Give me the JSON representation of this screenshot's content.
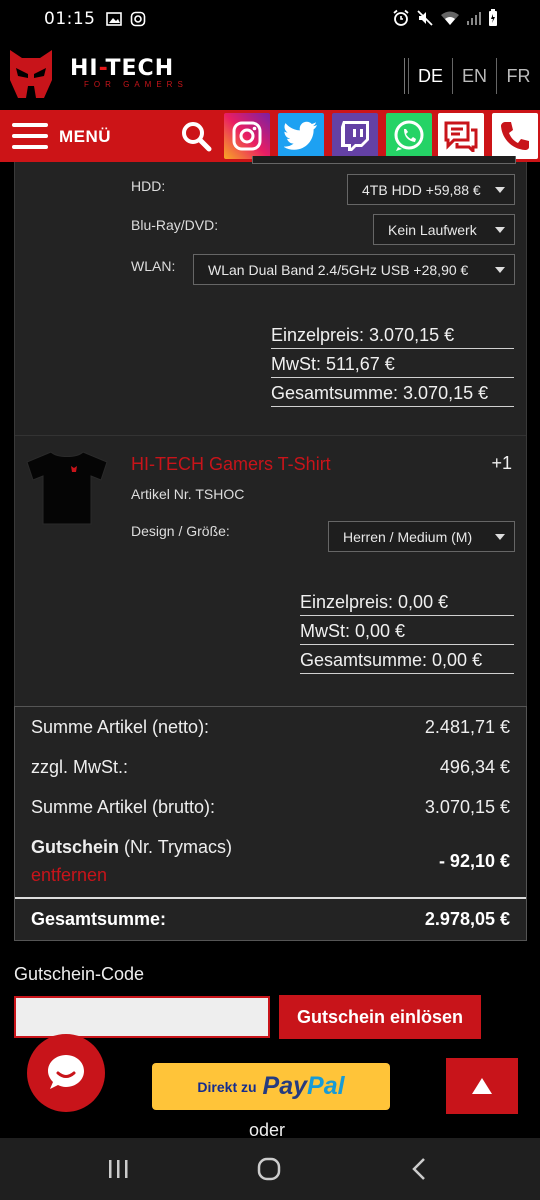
{
  "status_bar": {
    "time": "01:15"
  },
  "header": {
    "brand_main": "HI-TECH",
    "brand_sub": "FOR GAMERS",
    "languages": [
      "DE",
      "EN",
      "FR"
    ],
    "active_language": "DE"
  },
  "nav": {
    "menu_label": "MENÜ",
    "social": [
      "instagram",
      "twitter",
      "twitch",
      "whatsapp",
      "chat",
      "phone"
    ]
  },
  "config_options": [
    {
      "label": "HDD:",
      "value": "4TB HDD +59,88 €"
    },
    {
      "label": "Blu-Ray/DVD:",
      "value": "Kein Laufwerk"
    },
    {
      "label": "WLAN:",
      "value": "WLan Dual Band 2.4/5GHz USB +28,90 €"
    }
  ],
  "pc_prices": {
    "einzelpreis": "Einzelpreis: 3.070,15 €",
    "mwst": "MwSt: 511,67 €",
    "gesamtsumme": "Gesamtsumme: 3.070,15 €"
  },
  "tshirt": {
    "title": "HI-TECH Gamers T-Shirt",
    "quantity": "+1",
    "article_nr": "Artikel Nr. TSHOC",
    "design_label": "Design / Größe:",
    "design_value": "Herren / Medium (M)",
    "einzelpreis": "Einzelpreis: 0,00 €",
    "mwst": "MwSt: 0,00 €",
    "gesamtsumme": "Gesamtsumme: 0,00 €"
  },
  "summary": {
    "netto_label": "Summe Artikel (netto):",
    "netto_value": "2.481,71 €",
    "mwst_label": "zzgl. MwSt.:",
    "mwst_value": "496,34 €",
    "brutto_label": "Summe Artikel (brutto):",
    "brutto_value": "3.070,15 €",
    "gutschein_label": "Gutschein",
    "gutschein_nr": "(Nr. Trymacs)",
    "gutschein_remove": "entfernen",
    "gutschein_value": "- 92,10 €",
    "total_label": "Gesamtsumme:",
    "total_value": "2.978,05 €"
  },
  "voucher": {
    "label": "Gutschein-Code",
    "placeholder": "",
    "button": "Gutschein einlösen"
  },
  "checkout": {
    "paypal_prefix": "Direkt zu",
    "paypal_pay": "Pay",
    "paypal_pal": "Pal",
    "oder": "oder"
  },
  "colors": {
    "brand_red": "#cc1417",
    "panel": "#232323"
  }
}
